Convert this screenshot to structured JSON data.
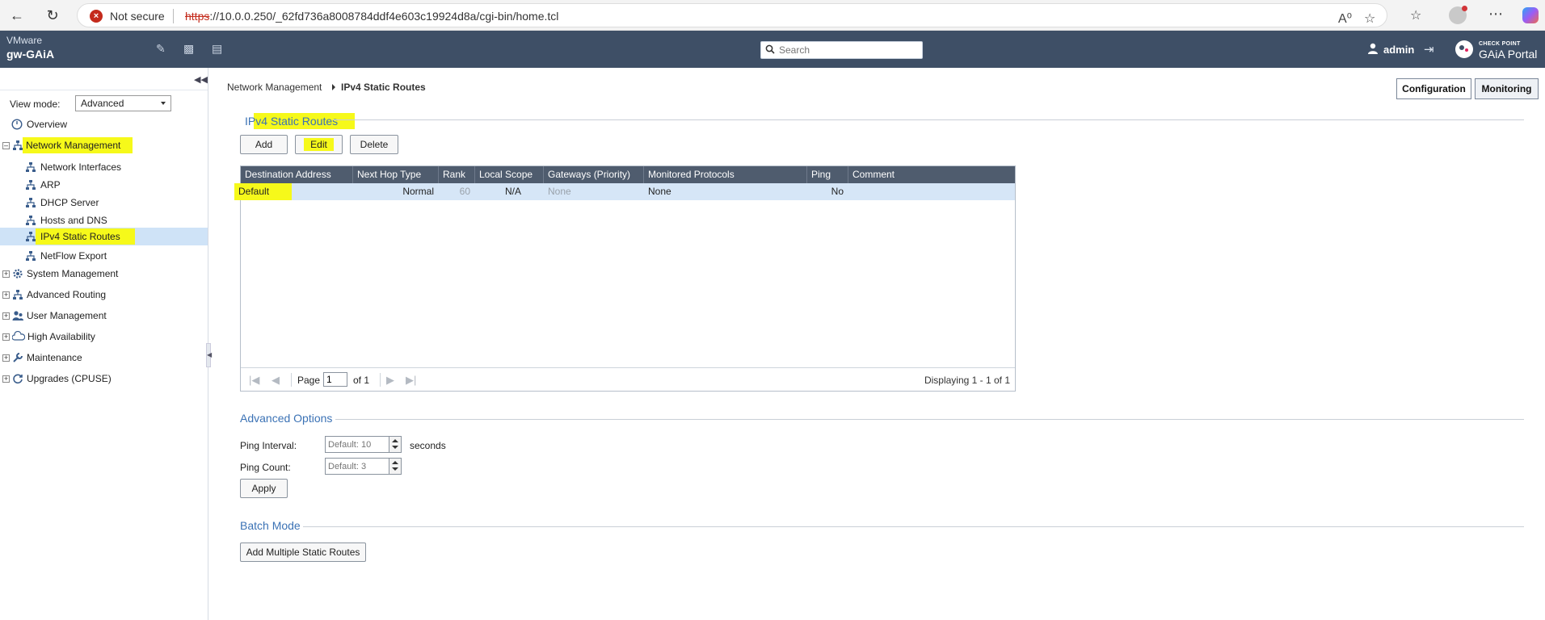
{
  "browser": {
    "security_label": "Not secure",
    "url_scheme": "https",
    "url_rest": "://10.0.0.250/_62fd736a8008784ddf4e603c19924d8a/cgi-bin/home.tcl"
  },
  "header": {
    "vendor": "VMware",
    "hostname": "gw-GAiA",
    "search_placeholder": "Search",
    "user": "admin",
    "brand_small": "CHECK POINT",
    "brand_name": "GAiA Portal"
  },
  "sidebar": {
    "view_mode_label": "View mode:",
    "view_mode_value": "Advanced",
    "items": [
      {
        "label": "Overview",
        "icon": "overview-icon"
      },
      {
        "label": "Network Management",
        "icon": "network-icon",
        "expanded": true,
        "highlighted": true
      },
      {
        "label": "Network Interfaces",
        "icon": "network-icon"
      },
      {
        "label": "ARP",
        "icon": "network-icon"
      },
      {
        "label": "DHCP Server",
        "icon": "network-icon"
      },
      {
        "label": "Hosts and DNS",
        "icon": "network-icon"
      },
      {
        "label": "IPv4 Static Routes",
        "icon": "network-icon",
        "selected": true,
        "highlighted": true
      },
      {
        "label": "NetFlow Export",
        "icon": "network-icon"
      },
      {
        "label": "System Management",
        "icon": "gear-icon"
      },
      {
        "label": "Advanced Routing",
        "icon": "network-icon"
      },
      {
        "label": "User Management",
        "icon": "users-icon"
      },
      {
        "label": "High Availability",
        "icon": "cloud-icon"
      },
      {
        "label": "Maintenance",
        "icon": "wrench-icon"
      },
      {
        "label": "Upgrades (CPUSE)",
        "icon": "refresh-icon"
      }
    ]
  },
  "breadcrumb": {
    "parent": "Network Management",
    "current": "IPv4 Static Routes"
  },
  "top_buttons": {
    "configuration": "Configuration",
    "monitoring": "Monitoring"
  },
  "routes_section": {
    "title": "IPv4 Static Routes",
    "add": "Add",
    "edit": "Edit",
    "delete": "Delete"
  },
  "grid": {
    "columns": [
      "Destination Address",
      "Next Hop Type",
      "Rank",
      "Local Scope",
      "Gateways (Priority)",
      "Monitored Protocols",
      "Ping",
      "Comment"
    ],
    "rows": [
      [
        "Default",
        "Normal",
        "60",
        "N/A",
        "None",
        "None",
        "No",
        ""
      ]
    ],
    "pager": {
      "page_label": "Page",
      "page_value": "1",
      "of_label": "of 1",
      "displaying": "Displaying 1 - 1 of 1"
    }
  },
  "advanced": {
    "title": "Advanced Options",
    "ping_interval_label": "Ping Interval:",
    "ping_interval_placeholder": "Default: 10",
    "ping_interval_unit": "seconds",
    "ping_count_label": "Ping Count:",
    "ping_count_placeholder": "Default: 3",
    "apply": "Apply"
  },
  "batch": {
    "title": "Batch Mode",
    "add_multiple": "Add Multiple Static Routes"
  },
  "colors": {
    "header_bg": "#3e4f66",
    "grid_header_bg": "#4f5c6e",
    "section_title": "#3b72b5",
    "highlight": "#f6f91a",
    "selected_row": "#cfe3f7"
  }
}
